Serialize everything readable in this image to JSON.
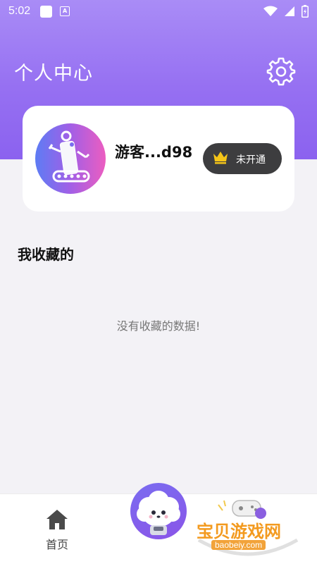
{
  "status_bar": {
    "time": "5:02",
    "a_badge": "A"
  },
  "header": {
    "title": "个人中心"
  },
  "profile": {
    "username": "游客...d98",
    "vip_label": "未开通"
  },
  "favorites": {
    "title": "我收藏的",
    "empty_message": "没有收藏的数据!"
  },
  "bottom_nav": {
    "home_label": "首页"
  },
  "watermark": {
    "text": "宝贝游戏网",
    "url": "baobeiy.com"
  },
  "colors": {
    "header_gradient_start": "#a98cf6",
    "header_gradient_end": "#8b62ef",
    "vip_button": "#3d3d3f",
    "crown": "#f5c518",
    "background": "#f3f2f6"
  }
}
